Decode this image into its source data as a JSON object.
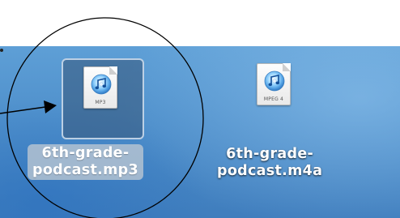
{
  "desktop": {
    "files": [
      {
        "name_line1": "6th-grade-",
        "name_line2": "podcast.mp3",
        "type_badge": "MP3",
        "icon": "itunes-audio-document-icon",
        "selected": true
      },
      {
        "name_line1": "6th-grade-",
        "name_line2": "podcast.m4a",
        "type_badge": "MPEG 4",
        "icon": "itunes-audio-document-icon",
        "selected": false
      }
    ]
  },
  "annotation": {
    "shapes": [
      "circle-highlight",
      "arrow-pointer"
    ],
    "stroke_color": "#000000"
  },
  "colors": {
    "desktop_blue": "#4e8fcb",
    "selection_tile": "#375578",
    "label_text": "#ffffff"
  }
}
